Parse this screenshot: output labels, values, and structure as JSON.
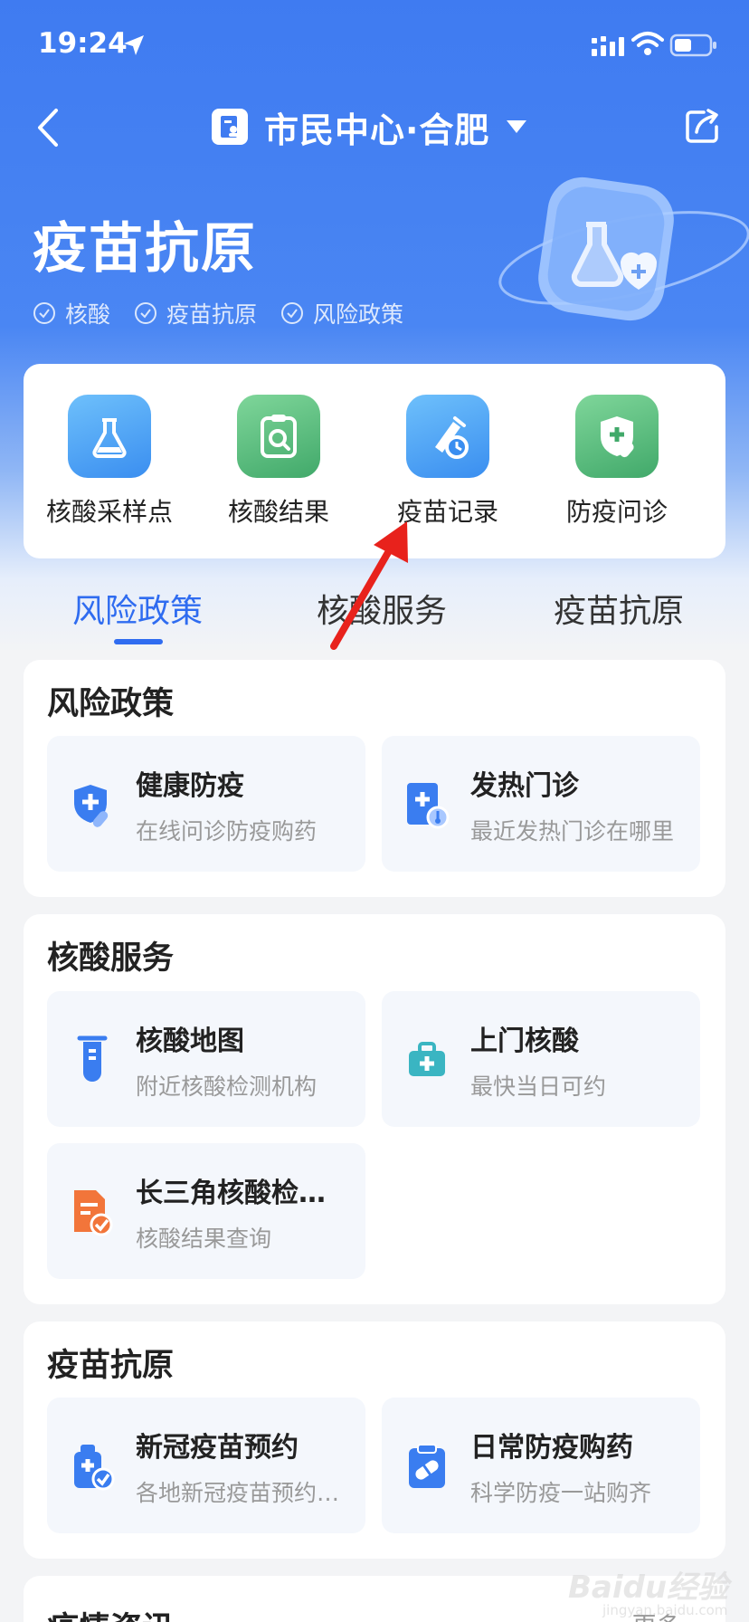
{
  "status_bar": {
    "time": "19:24"
  },
  "nav": {
    "title": "市民中心·合肥"
  },
  "header": {
    "title": "疫苗抗原",
    "checks": [
      "核酸",
      "疫苗抗原",
      "风险政策"
    ]
  },
  "quick_actions": [
    {
      "label": "核酸采样点",
      "icon": "flask-icon",
      "color": "#4aa4f5"
    },
    {
      "label": "核酸结果",
      "icon": "report-search-icon",
      "color": "#56b978"
    },
    {
      "label": "疫苗记录",
      "icon": "vaccine-record-icon",
      "color": "#4aa4f5"
    },
    {
      "label": "防疫问诊",
      "icon": "shield-medicine-icon",
      "color": "#56b978"
    }
  ],
  "tabs": [
    {
      "label": "风险政策",
      "active": true
    },
    {
      "label": "核酸服务",
      "active": false
    },
    {
      "label": "疫苗抗原",
      "active": false
    }
  ],
  "sections": {
    "risk": {
      "title": "风险政策",
      "tiles": [
        {
          "title": "健康防疫",
          "sub": "在线问诊防疫购药",
          "icon": "health-shield-icon"
        },
        {
          "title": "发热门诊",
          "sub": "最近发热门诊在哪里",
          "icon": "fever-clinic-icon"
        }
      ]
    },
    "nucleic": {
      "title": "核酸服务",
      "tiles": [
        {
          "title": "核酸地图",
          "sub": "附近核酸检测机构",
          "icon": "test-tube-icon"
        },
        {
          "title": "上门核酸",
          "sub": "最快当日可约",
          "icon": "medical-kit-icon"
        },
        {
          "title": "长三角核酸检…",
          "sub": "核酸结果查询",
          "icon": "document-check-icon"
        }
      ]
    },
    "vaccine": {
      "title": "疫苗抗原",
      "tiles": [
        {
          "title": "新冠疫苗预约",
          "sub": "各地新冠疫苗预约…",
          "icon": "vaccine-booking-icon"
        },
        {
          "title": "日常防疫购药",
          "sub": "科学防疫一站购齐",
          "icon": "pill-clipboard-icon"
        }
      ]
    },
    "news": {
      "title": "疫情资讯",
      "more": "更多"
    }
  },
  "watermark": {
    "text": "Baidu经验",
    "sub": "jingyan.baidu.com"
  },
  "colors": {
    "accent": "#2f6cf0",
    "header_blue": "#3f7bf1"
  }
}
